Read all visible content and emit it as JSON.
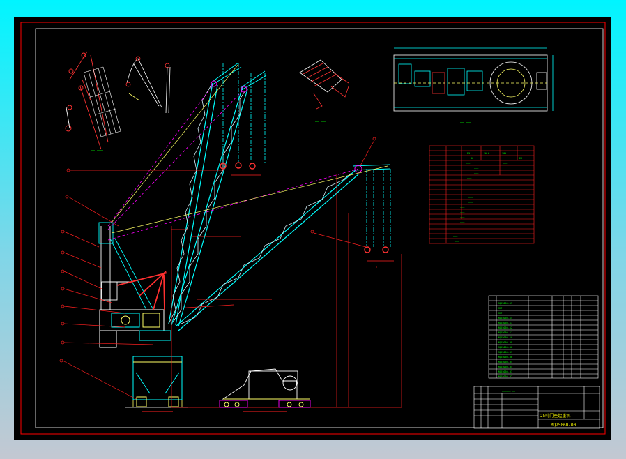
{
  "colors": {
    "canvas_bg": "#000000",
    "frame": "#ff0000",
    "inner_frame": "#ffffff",
    "boom_structure": "#00ffff",
    "boom_fill": "#d9f6ff",
    "dimension": "#ff2020",
    "label_text": "#00ff00",
    "cable": "#ffff66",
    "luffing_line": "#ff00ff",
    "table_line": "#ff0000",
    "table_text": "#00ff00",
    "title_text": "#ffff00",
    "highlight": "#ff3333"
  },
  "drawing": {
    "number": "MQ25060-00",
    "title": "25吨门座起重机"
  },
  "icons": {
    "hook_high_1": "crane-hook-icon",
    "hook_high_2": "crane-hook-icon",
    "hook_high_3": "crane-hook-icon",
    "hook_low_1": "crane-hook-icon",
    "hook_low_2": "crane-hook-icon",
    "winch_drum": "winch-drum-icon"
  }
}
